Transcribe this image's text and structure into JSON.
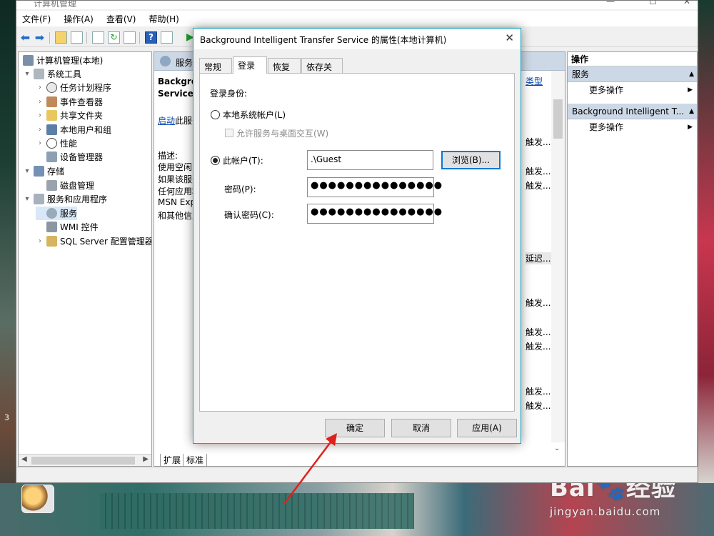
{
  "window": {
    "title": "计算机管理",
    "min": "—",
    "max": "☐",
    "close": "✕"
  },
  "menu": [
    "文件(F)",
    "操作(A)",
    "查看(V)",
    "帮助(H)"
  ],
  "tree": {
    "items": [
      {
        "label": "计算机管理(本地)",
        "level": 0,
        "twisty": ""
      },
      {
        "label": "系统工具",
        "level": 1,
        "twisty": "▾"
      },
      {
        "label": "任务计划程序",
        "level": 2,
        "twisty": "›"
      },
      {
        "label": "事件查看器",
        "level": 2,
        "twisty": "›"
      },
      {
        "label": "共享文件夹",
        "level": 2,
        "twisty": "›"
      },
      {
        "label": "本地用户和组",
        "level": 2,
        "twisty": "›"
      },
      {
        "label": "性能",
        "level": 2,
        "twisty": "›"
      },
      {
        "label": "设备管理器",
        "level": 2,
        "twisty": ""
      },
      {
        "label": "存储",
        "level": 1,
        "twisty": "▾"
      },
      {
        "label": "磁盘管理",
        "level": 2,
        "twisty": ""
      },
      {
        "label": "服务和应用程序",
        "level": 1,
        "twisty": "▾"
      },
      {
        "label": "服务",
        "level": 2,
        "twisty": ""
      },
      {
        "label": "WMI 控件",
        "level": 2,
        "twisty": ""
      },
      {
        "label": "SQL Server 配置管理器",
        "level": 2,
        "twisty": "›"
      }
    ]
  },
  "center": {
    "header": "服务",
    "service_name_1": "Backgrou",
    "service_name_2": "Service",
    "start_link": "启动",
    "start_rest": "此服务",
    "desc_label": "描述:",
    "desc_lines": [
      "使用空闲网",
      "如果该服务",
      "任何应用程",
      "MSN Exp",
      "和其他信息"
    ],
    "right_col": [
      "类型",
      "触发...",
      "触发...",
      "触发...",
      "延迟...",
      "触发...",
      "触发...",
      "触发...",
      "触发...",
      "触发..."
    ],
    "tabs": [
      "扩展",
      "标准"
    ]
  },
  "actions": {
    "title": "操作",
    "section1": "服务",
    "section1_item": "更多操作",
    "section2": "Background Intelligent T...",
    "section2_item": "更多操作"
  },
  "dialog": {
    "title": "Background Intelligent Transfer Service 的属性(本地计算机)",
    "close": "✕",
    "tabs": [
      "常规",
      "登录",
      "恢复",
      "依存关系"
    ],
    "logon_as": "登录身份:",
    "local_system": "本地系统帐户(L)",
    "allow_desktop": "允许服务与桌面交互(W)",
    "this_account": "此帐户(T):",
    "account_value": ".\\Guest",
    "browse": "浏览(B)...",
    "password_label": "密码(P):",
    "password_value": "●●●●●●●●●●●●●●●",
    "confirm_label": "确认密码(C):",
    "confirm_value": "●●●●●●●●●●●●●●●",
    "ok": "确定",
    "cancel": "取消",
    "apply": "应用(A)"
  },
  "watermark": {
    "main": "Bai🐾经验",
    "sub": "jingyan.baidu.com"
  },
  "desktop": {
    "side_num": "3"
  },
  "colors": {
    "accent": "#0a78d7",
    "dialog_border": "#1aa3b9",
    "header_blue": "#cdd8e6",
    "arrow": "#e0201c"
  }
}
